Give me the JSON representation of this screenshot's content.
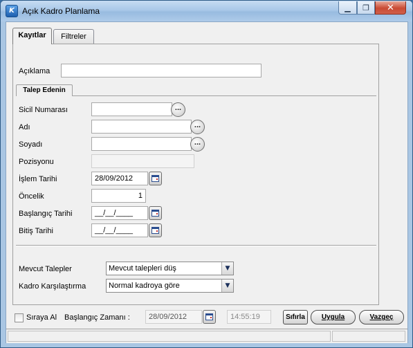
{
  "window": {
    "title": "Açık Kadro Planlama",
    "icon": "app-logo-icon",
    "controls": {
      "minimize": "▁",
      "maximize": "❐",
      "close": "✕"
    }
  },
  "tabs": [
    {
      "label": "Kayıtlar",
      "selected": true
    },
    {
      "label": "Filtreler",
      "selected": false
    }
  ],
  "form": {
    "aciklama_label": "Açıklama",
    "aciklama_value": "",
    "talep_edenin_label": "Talep Edenin",
    "sicil_label": "Sicil Numarası",
    "sicil_value": "",
    "adi_label": "Adı",
    "adi_value": "",
    "soyadi_label": "Soyadı",
    "soyadi_value": "",
    "pozisyonu_label": "Pozisyonu",
    "pozisyonu_value": "",
    "islem_tarihi_label": "İşlem Tarihi",
    "islem_tarihi_value": "28/09/2012",
    "oncelik_label": "Öncelik",
    "oncelik_value": "1",
    "baslangic_tarihi_label": "Başlangıç Tarihi",
    "baslangic_tarihi_value": "__/__/____",
    "bitis_tarihi_label": "Bitiş Tarihi",
    "bitis_tarihi_value": "__/__/____",
    "ellipsis": "...",
    "mevcut_talepler_label": "Mevcut Talepler",
    "mevcut_talepler_value": "Mevcut talepleri düş",
    "kadro_karsilastirma_label": "Kadro Karşılaştırma",
    "kadro_karsilastirma_value": "Normal kadroya göre"
  },
  "bottom": {
    "siraya_al_label": "Sıraya Al",
    "siraya_al_checked": false,
    "baslangic_zamani_label": "Başlangıç Zamanı :",
    "baslangic_zamani_date": "28/09/2012",
    "baslangic_zamani_time": "14:55:19",
    "sifirla_label": "Sıfırla",
    "uygula_label": "Uygula",
    "vazgec_label": "Vazgeç"
  },
  "statusbar": {
    "left": "",
    "right": ""
  },
  "colors": {
    "titlebar": "#aac8e8",
    "close_button": "#c94a33",
    "calendar_icon": "#2a4d8f"
  }
}
